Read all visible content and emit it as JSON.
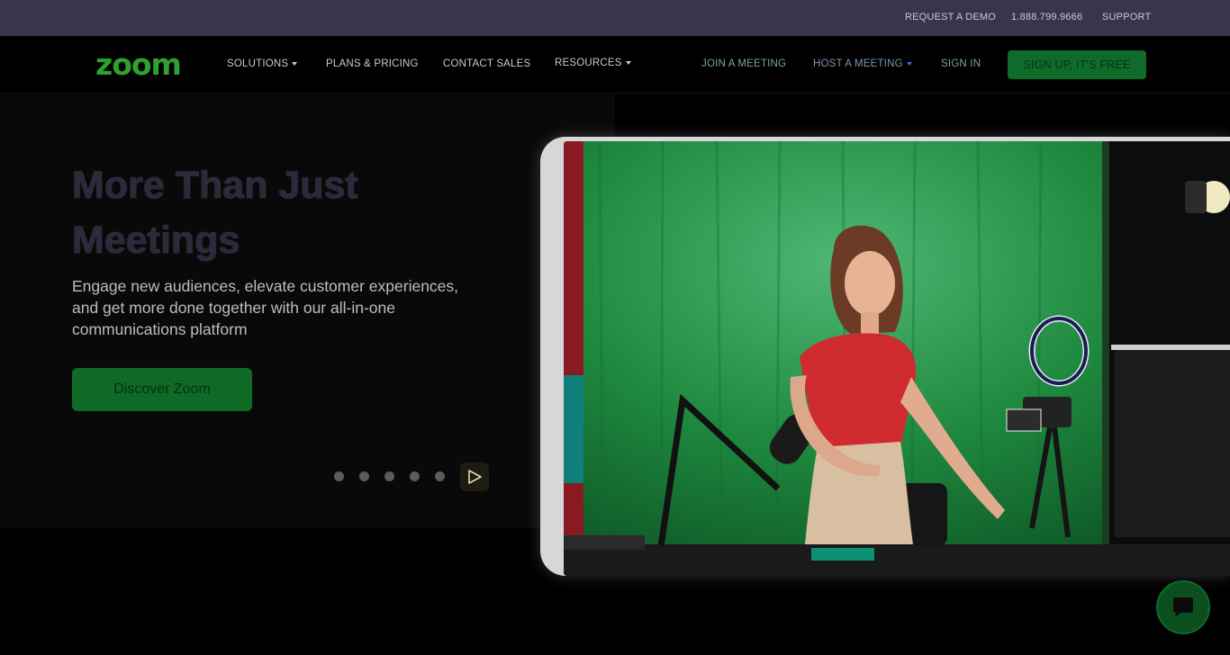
{
  "topbar": {
    "request_demo": "REQUEST A DEMO",
    "phone": "1.888.799.9666",
    "support": "SUPPORT"
  },
  "nav": {
    "logo": "zoom",
    "solutions": "SOLUTIONS",
    "plans": "PLANS & PRICING",
    "contact": "CONTACT SALES",
    "resources": "RESOURCES",
    "join": "JOIN A MEETING",
    "host": "HOST A MEETING",
    "signin": "SIGN IN",
    "signup": "SIGN UP, IT'S FREE"
  },
  "hero": {
    "title_line1": "More Than Just",
    "title_line2": "Meetings",
    "subtitle": "Engage new audiences, elevate customer experiences, and get more done together with our all-in-one communications platform",
    "cta": "Discover Zoom",
    "slides": 5
  },
  "colors": {
    "brand_green": "#2ea12e",
    "button_green": "#0f6b2a",
    "topbar_bg": "#37364d"
  },
  "icons": {
    "play": "play-icon",
    "chat": "chat-bubble-icon",
    "caret": "chevron-down-icon"
  }
}
